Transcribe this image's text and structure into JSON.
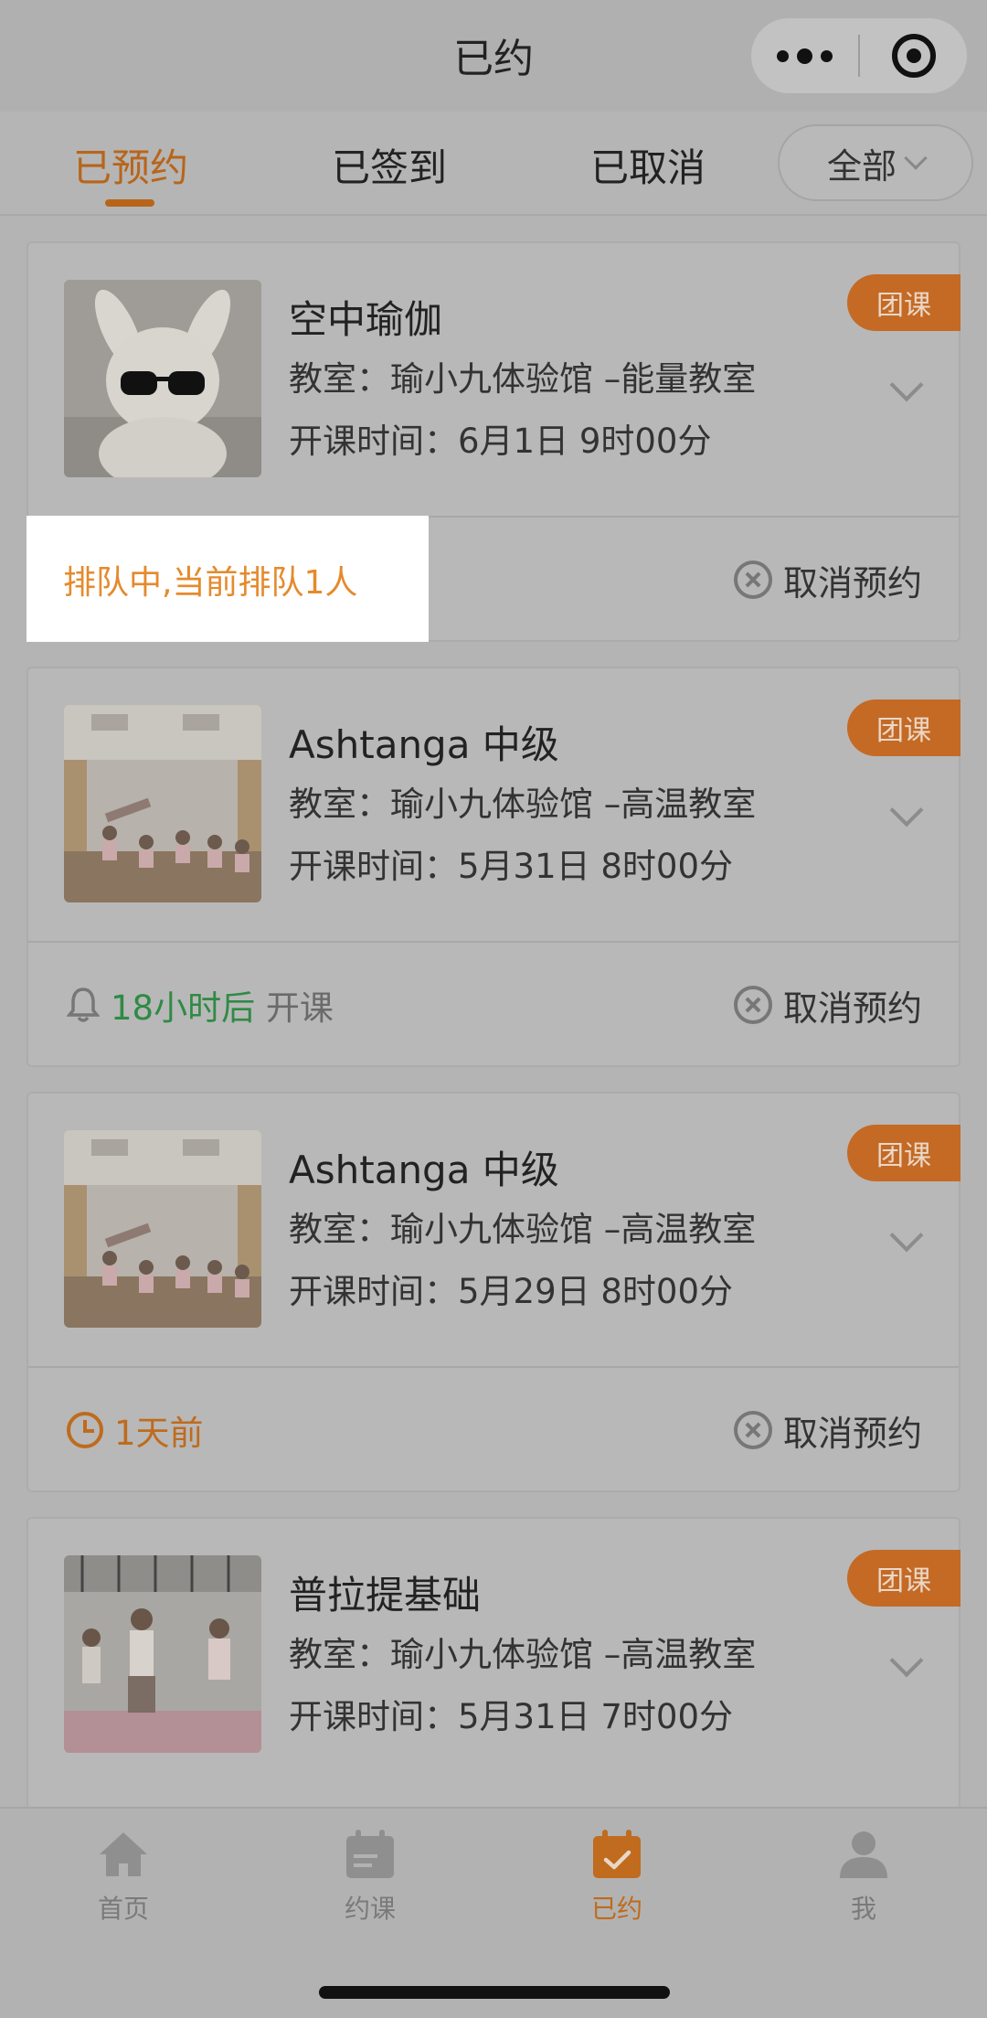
{
  "header": {
    "title": "已约"
  },
  "tabs": [
    {
      "label": "已预约",
      "active": true
    },
    {
      "label": "已签到",
      "active": false
    },
    {
      "label": "已取消",
      "active": false
    }
  ],
  "filter": {
    "label": "全部"
  },
  "cards": [
    {
      "course": "空中瑜伽",
      "room": "教室：瑜小九体验馆 –能量教室",
      "time": "开课时间：6月1日 9时00分",
      "badge": "团课",
      "status_text": "排队中,当前排队1人",
      "cancel_label": "取消预约"
    },
    {
      "course": "Ashtanga 中级",
      "room": "教室：瑜小九体验馆 –高温教室",
      "time": "开课时间：5月31日 8时00分",
      "badge": "团课",
      "status_highlight": "18小时后",
      "status_suffix": " 开课",
      "cancel_label": "取消预约"
    },
    {
      "course": "Ashtanga 中级",
      "room": "教室：瑜小九体验馆 –高温教室",
      "time": "开课时间：5月29日 8时00分",
      "badge": "团课",
      "status_text": "1天前",
      "cancel_label": "取消预约"
    },
    {
      "course": "普拉提基础",
      "room": "教室：瑜小九体验馆 –高温教室",
      "time": "开课时间：5月31日 7时00分",
      "badge": "团课"
    }
  ],
  "tabbar": [
    {
      "label": "首页",
      "icon": "home-icon",
      "active": false
    },
    {
      "label": "约课",
      "icon": "calendar-icon",
      "active": false
    },
    {
      "label": "已约",
      "icon": "calendar-check-icon",
      "active": true
    },
    {
      "label": "我",
      "icon": "user-icon",
      "active": false
    }
  ],
  "colors": {
    "accent": "#bf6b1d",
    "highlight_text": "#e58a2c",
    "green": "#2f8a45"
  }
}
